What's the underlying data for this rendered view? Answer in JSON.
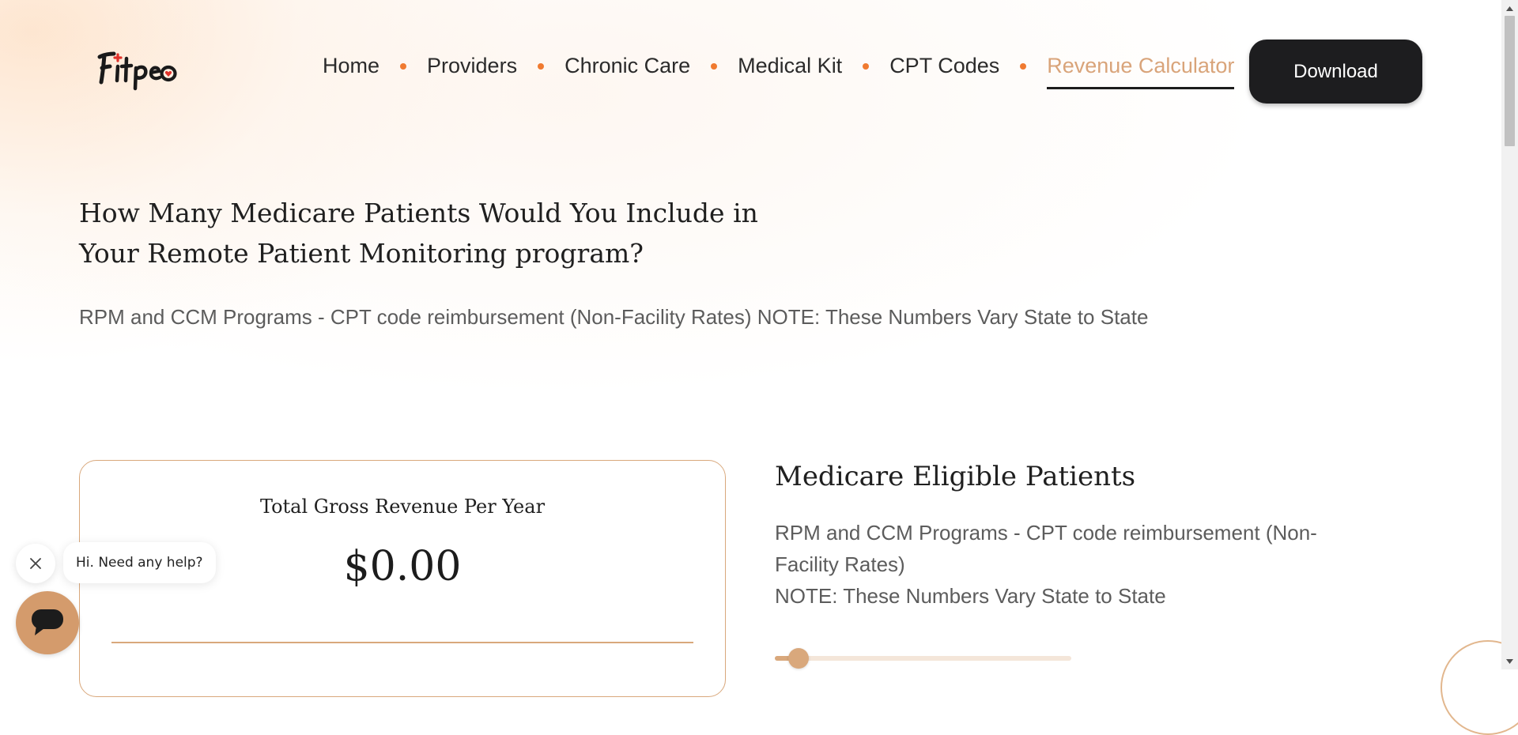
{
  "brand": {
    "logo_text": "Fitpeo"
  },
  "nav": {
    "items": [
      {
        "label": "Home",
        "active": false
      },
      {
        "label": "Providers",
        "active": false
      },
      {
        "label": "Chronic Care",
        "active": false
      },
      {
        "label": "Medical Kit",
        "active": false
      },
      {
        "label": "CPT Codes",
        "active": false
      },
      {
        "label": "Revenue Calculator",
        "active": true
      }
    ],
    "download_label": "Download"
  },
  "hero": {
    "title_line1": "How Many Medicare Patients Would You Include in",
    "title_line2": "Your Remote Patient Monitoring program?",
    "note": "RPM and CCM Programs - CPT code reimbursement (Non-Facility Rates) NOTE: These Numbers Vary State to State"
  },
  "revenue_card": {
    "label": "Total Gross Revenue Per Year",
    "value": "$0.00"
  },
  "eligible": {
    "title": "Medicare Eligible Patients",
    "desc_line1": "RPM and CCM Programs - CPT code reimbursement (Non-",
    "desc_line2": "Facility Rates)",
    "desc_line3": "NOTE: These Numbers Vary State to State",
    "slider_fraction": 0.08
  },
  "chat": {
    "greeting": "Hi. Need any help?"
  },
  "colors": {
    "accent": "#d9a87c",
    "nav_active": "#d9a47a",
    "nav_dot": "#f07a30",
    "button_bg": "#1d1d1f",
    "chat_launcher": "#d49b6c"
  },
  "icons": {
    "close": "close-icon",
    "chat": "chat-bubble-icon",
    "scroll_up": "triangle-up-icon",
    "scroll_down": "triangle-down-icon"
  }
}
